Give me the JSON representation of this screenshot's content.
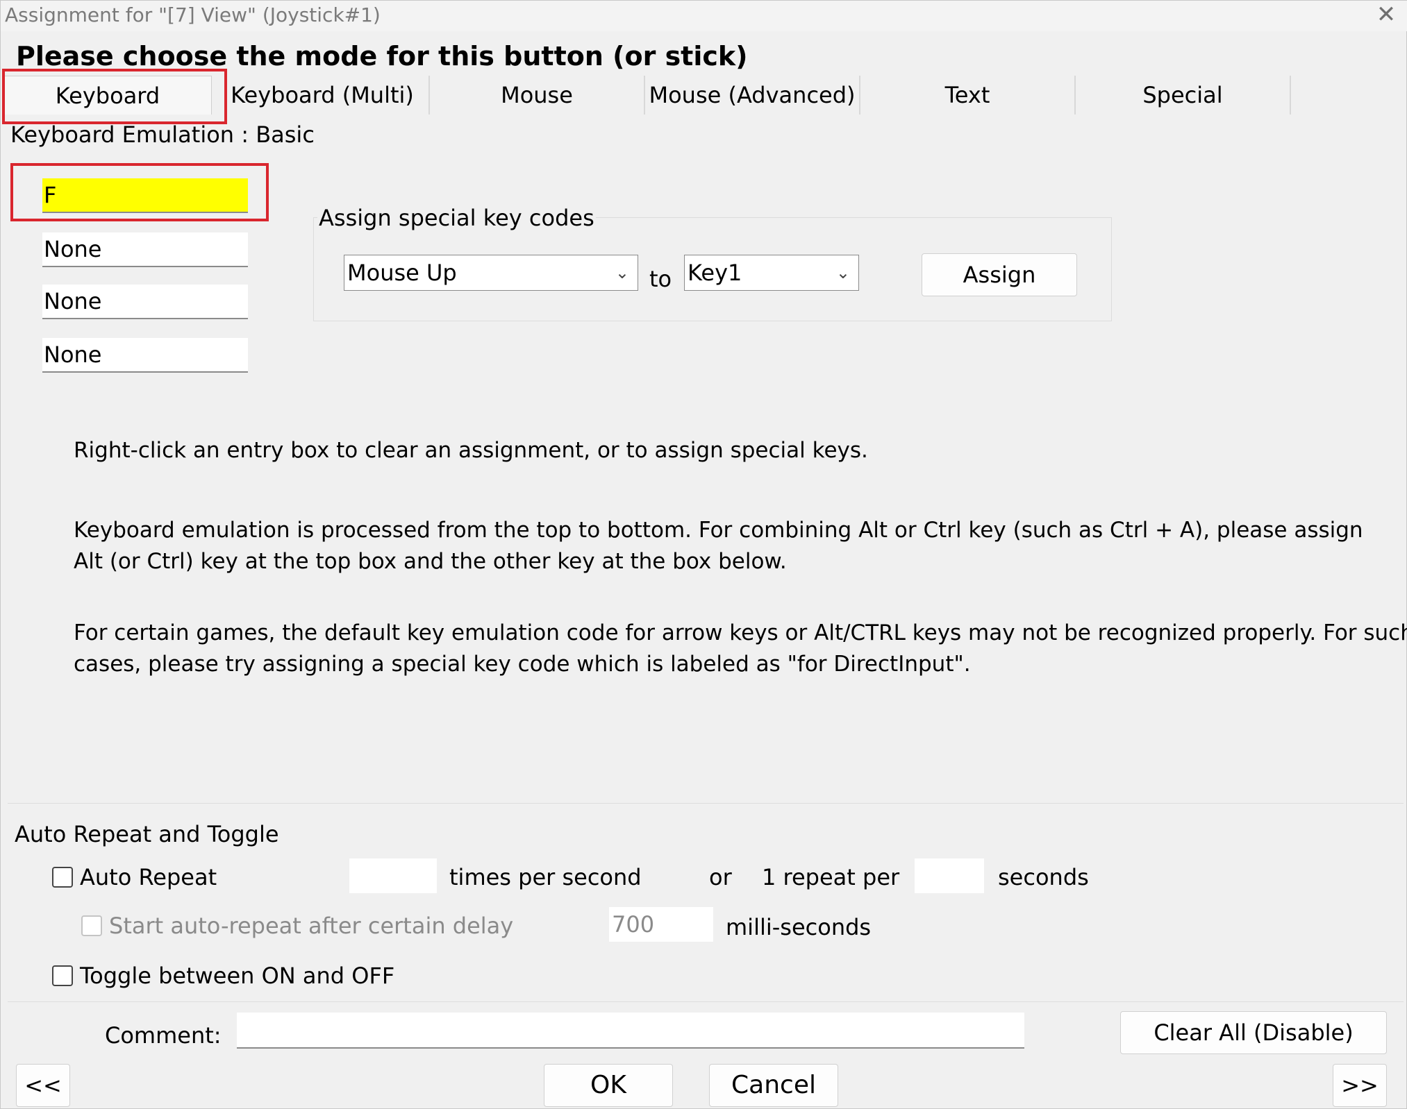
{
  "window": {
    "title": "Assignment for \"[7] View\" (Joystick#1)",
    "close_glyph": "✕"
  },
  "heading": "Please choose the mode for this button (or stick)",
  "tabs": [
    {
      "label": "Keyboard",
      "selected": true
    },
    {
      "label": "Keyboard (Multi)",
      "selected": false
    },
    {
      "label": "Mouse",
      "selected": false
    },
    {
      "label": "Mouse (Advanced)",
      "selected": false
    },
    {
      "label": "Text",
      "selected": false
    },
    {
      "label": "Special",
      "selected": false
    }
  ],
  "keyboard": {
    "mode_label": "Keyboard Emulation : Basic",
    "key_boxes": [
      "F",
      "None",
      "None",
      "None"
    ],
    "special": {
      "group_label": "Assign special key codes",
      "source_value": "Mouse Up",
      "to_label": "to",
      "target_value": "Key1",
      "assign_label": "Assign"
    },
    "help": [
      [
        "Right-click an entry box to clear an assignment, or to assign special keys."
      ],
      [
        "Keyboard emulation is processed from the top to bottom.  For combining Alt or Ctrl key (such as Ctrl + A), please assign",
        "Alt (or Ctrl) key at the top box and the other key at the box below."
      ],
      [
        "For certain games, the default key emulation code for arrow keys or Alt/CTRL keys may not be recognized properly.  For such",
        "cases, please try assigning a special key code which is labeled as \"for DirectInput\"."
      ]
    ]
  },
  "auto_repeat": {
    "group_label": "Auto Repeat and Toggle",
    "auto_repeat_label": "Auto Repeat",
    "auto_repeat_checked": false,
    "times_value": "",
    "times_label": "times per second",
    "or_label": "or",
    "repeat_per_label": "1 repeat per",
    "seconds_value": "",
    "seconds_label": "seconds",
    "delay_label": "Start auto-repeat after certain delay",
    "delay_checked": false,
    "delay_value": "700",
    "delay_unit": "milli-seconds",
    "toggle_label": "Toggle between ON and OFF",
    "toggle_checked": false
  },
  "footer": {
    "comment_label": "Comment:",
    "comment_value": "",
    "clear_all_label": "Clear All (Disable)",
    "prev_label": "<<",
    "ok_label": "OK",
    "cancel_label": "Cancel",
    "next_label": ">>"
  },
  "colors": {
    "active_key_highlight": "#ffff00",
    "annotation_red": "#d9262e"
  },
  "icons": {
    "close": "close-icon",
    "dropdown": "chevron-down-icon"
  }
}
